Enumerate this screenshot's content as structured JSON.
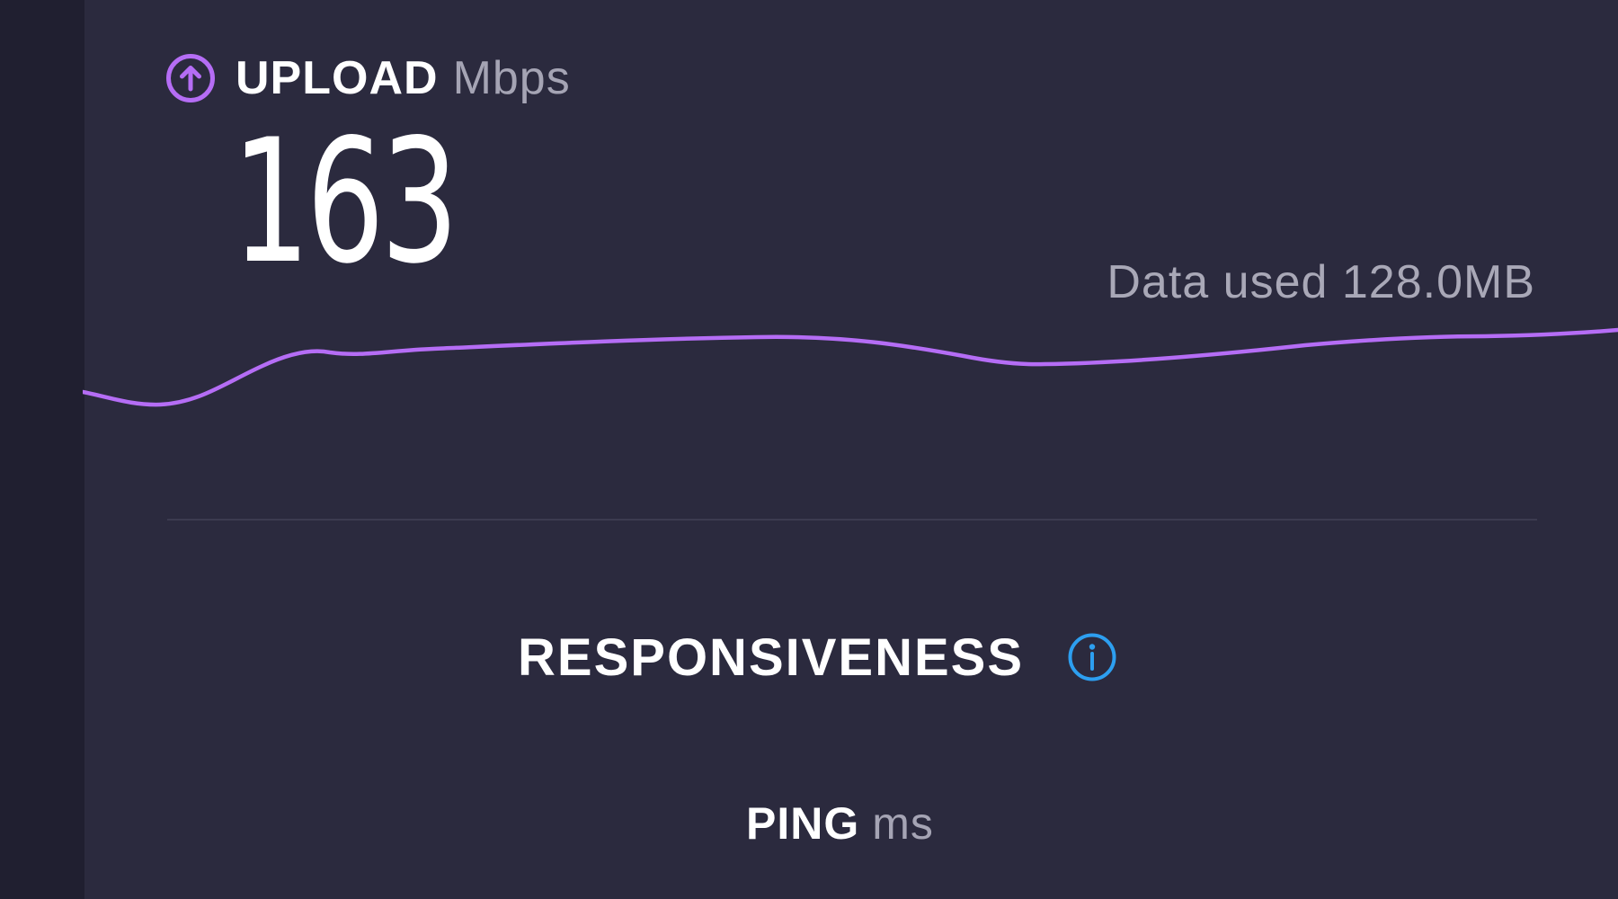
{
  "upload": {
    "label": "UPLOAD",
    "unit": "Mbps",
    "value": "163",
    "icon": "upload-arrow-circle-icon"
  },
  "data_used": "Data used 128.0MB",
  "responsiveness": {
    "label": "RESPONSIVENESS",
    "icon": "info-icon"
  },
  "ping": {
    "label": "PING",
    "unit": "ms"
  },
  "colors": {
    "background": "#2b2a3e",
    "left_strip": "#201f30",
    "accent_purple": "#b56df5",
    "info_blue": "#2d9ff0",
    "text_primary": "#ffffff",
    "text_secondary": "#a5a4b4",
    "divider": "#3c3b50"
  }
}
